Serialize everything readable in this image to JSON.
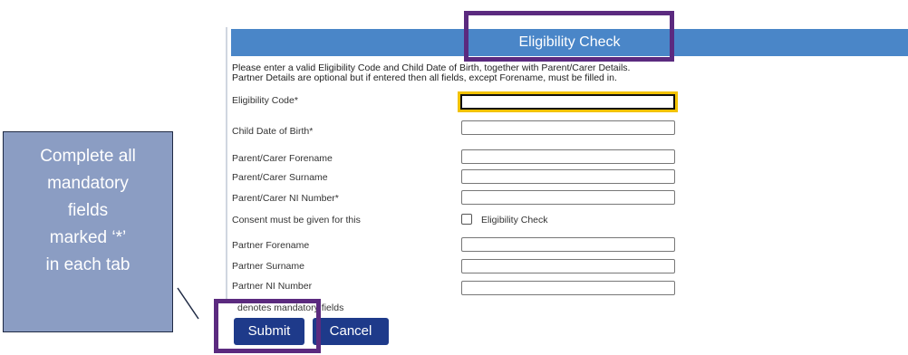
{
  "form": {
    "title": "Eligibility Check",
    "instructions_line1": "Please enter a valid Eligibility Code and Child Date of Birth, together with Parent/Carer Details.",
    "instructions_line2": "Partner Details are optional but if entered then all fields, except Forename, must be filled in.",
    "fields": {
      "eligibility_code": "Eligibility Code*",
      "child_dob": "Child Date of Birth*",
      "parent_forename": "Parent/Carer Forename",
      "parent_surname": "Parent/Carer Surname",
      "parent_ni": "Parent/Carer NI Number*",
      "consent": "Consent must be given for this",
      "partner_forename": "Partner Forename",
      "partner_surname": "Partner Surname",
      "partner_ni": "Partner NI Number"
    },
    "consent_checkbox_label": "Eligibility Check",
    "mandatory_note": "denotes mandatory fields",
    "submit_label": "Submit",
    "cancel_label": "Cancel"
  },
  "callout": {
    "lines": [
      "Complete all",
      "mandatory",
      "fields",
      "marked ‘*’",
      "in each tab"
    ]
  },
  "colors": {
    "header": "#4a86c8",
    "highlight": "#5b2a7f",
    "focus": "#f2c200",
    "button": "#1e3a8a",
    "callout": "#8b9dc3"
  }
}
